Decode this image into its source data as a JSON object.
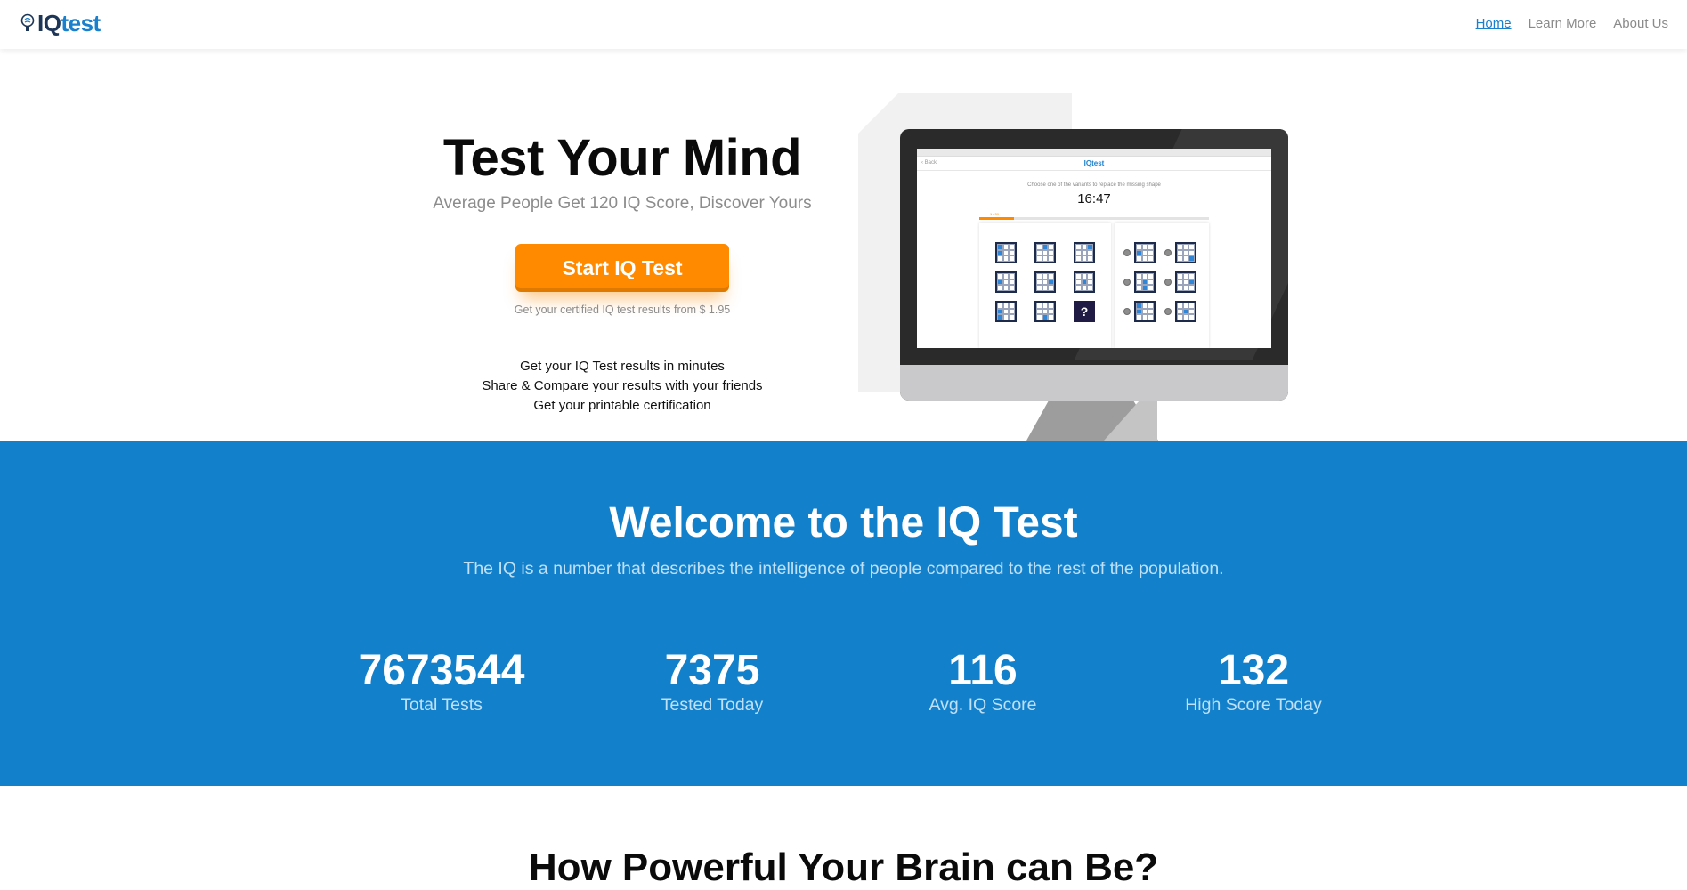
{
  "nav": {
    "logo_iq": "IQ",
    "logo_test": "test",
    "links": [
      "Home",
      "Learn More",
      "About Us"
    ]
  },
  "hero": {
    "title": "Test Your Mind",
    "subtitle": "Average People Get 120 IQ Score, Discover Yours",
    "cta_label": "Start IQ Test",
    "price_note": "Get your certified IQ test results from $ 1.95",
    "benefits": [
      "Get your IQ Test results in minutes",
      "Share & Compare your results with your friends",
      "Get your printable certification"
    ]
  },
  "preview": {
    "back_label": "Back",
    "logo": "IQtest",
    "instruction": "Choose one of the variants to replace the missing shape",
    "timer": "16:47",
    "progress_label": "1 / 39",
    "progress_fraction": 0.15,
    "question_mark": "?"
  },
  "welcome": {
    "title": "Welcome to the IQ Test",
    "subtitle": "The IQ is a number that describes the intelligence of people compared to the rest of the population."
  },
  "stats": [
    {
      "value": "7673544",
      "label": "Total Tests"
    },
    {
      "value": "7375",
      "label": "Tested Today"
    },
    {
      "value": "116",
      "label": "Avg. IQ Score"
    },
    {
      "value": "132",
      "label": "High Score Today"
    }
  ],
  "next_section": {
    "title": "How Powerful Your Brain can Be?"
  },
  "colors": {
    "brand_blue": "#1380cb",
    "accent_orange": "#ff8a00"
  }
}
